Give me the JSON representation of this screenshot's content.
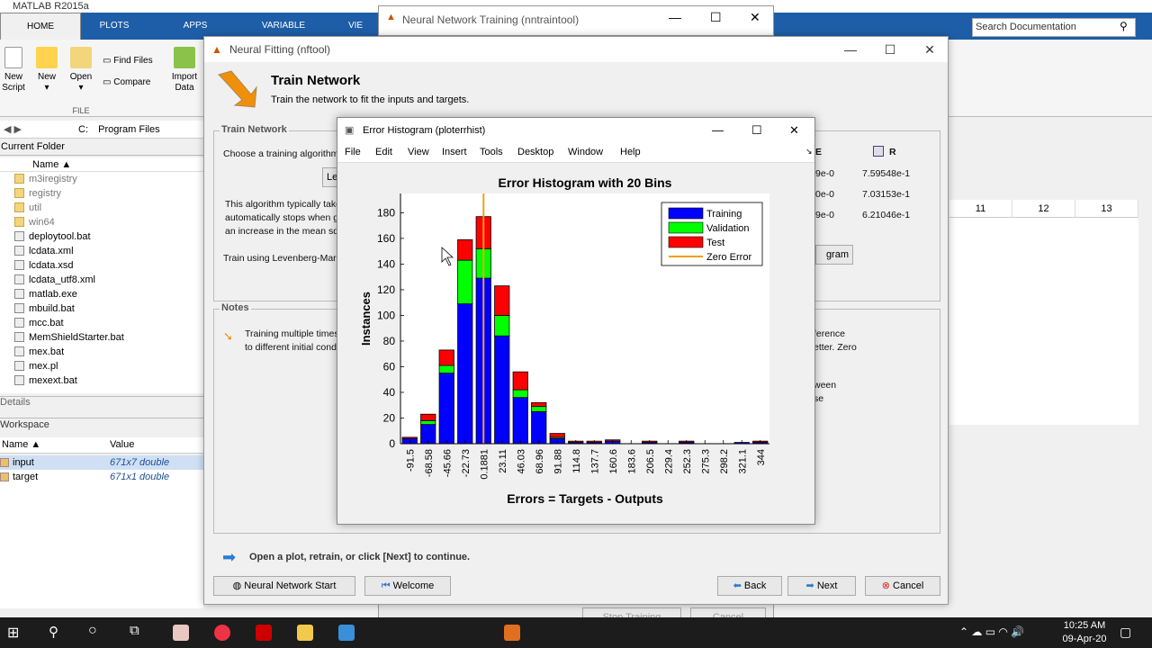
{
  "matlab": {
    "title": "MATLAB R2015a",
    "tabs": [
      "HOME",
      "PLOTS",
      "APPS",
      "VARIABLE",
      "VIE"
    ],
    "ribbon": {
      "new_script": "New\nScript",
      "new": "New",
      "open": "Open",
      "find_files": "Find Files",
      "compare": "Compare",
      "import_data": "Import\nData",
      "file_group": "FILE"
    },
    "search_placeholder": "Search Documentation",
    "path": [
      "C:",
      "Program Files"
    ],
    "current_folder_label": "Current Folder",
    "name_header": "Name",
    "files": [
      {
        "name": "m3iregistry",
        "folder": true
      },
      {
        "name": "registry",
        "folder": true
      },
      {
        "name": "util",
        "folder": true
      },
      {
        "name": "win64",
        "folder": true
      },
      {
        "name": "deploytool.bat",
        "folder": false
      },
      {
        "name": "lcdata.xml",
        "folder": false
      },
      {
        "name": "lcdata.xsd",
        "folder": false
      },
      {
        "name": "lcdata_utf8.xml",
        "folder": false
      },
      {
        "name": "matlab.exe",
        "folder": false
      },
      {
        "name": "mbuild.bat",
        "folder": false
      },
      {
        "name": "mcc.bat",
        "folder": false
      },
      {
        "name": "MemShieldStarter.bat",
        "folder": false
      },
      {
        "name": "mex.bat",
        "folder": false
      },
      {
        "name": "mex.pl",
        "folder": false
      },
      {
        "name": "mexext.bat",
        "folder": false
      }
    ],
    "details_label": "Details",
    "workspace_label": "Workspace",
    "ws_name_header": "Name",
    "ws_value_header": "Value",
    "workspace": [
      {
        "name": "input",
        "value": "671x7 double"
      },
      {
        "name": "target",
        "value": "671x1 double"
      }
    ],
    "grid_columns": [
      "11",
      "12",
      "13"
    ]
  },
  "nntraintool": {
    "title": "Neural Network Training (nntraintool)",
    "stop_training": "Stop Training",
    "cancel": "Cancel"
  },
  "nftool": {
    "title": "Neural Fitting (nftool)",
    "heading": "Train Network",
    "subheading": "Train the network to fit the inputs and targets.",
    "train_panel_title": "Train Network",
    "choose_text": "Choose a training algorithm:",
    "algo_button": "Lev",
    "algo_desc_1": "This algorithm typically takes more memory but less time. Training",
    "algo_desc_2": "automatically stops when generalization stops improving, as indicated by",
    "algo_desc_3": "an increase in the mean square error of the validation samples.",
    "train_using": "Train using Levenberg-Marquardt.",
    "results_headers": [
      "E",
      "R"
    ],
    "r_values": [
      "7.59548e-1",
      "7.03153e-1",
      "6.21046e-1"
    ],
    "mse_partial": [
      "9e-0",
      "0e-0",
      "9e-0"
    ],
    "plot_button": "gram",
    "notes_title": "Notes",
    "note_1a": "Training multiple times will generate different results due",
    "note_1b": "to different initial conditions and sampling.",
    "note_r1": "ference",
    "note_r2": "etter. Zero",
    "note_r3": "ween",
    "note_r4": "se",
    "footer_hint": "Open a plot, retrain, or click [Next] to continue.",
    "btn_nn_start": "Neural Network Start",
    "btn_welcome": "Welcome",
    "btn_back": "Back",
    "btn_next": "Next",
    "btn_cancel": "Cancel"
  },
  "histogram_window": {
    "title": "Error Histogram (ploterrhist)",
    "menu": [
      "File",
      "Edit",
      "View",
      "Insert",
      "Tools",
      "Desktop",
      "Window",
      "Help"
    ]
  },
  "chart_data": {
    "type": "bar",
    "title": "Error Histogram with 20 Bins",
    "xlabel": "Errors = Targets - Outputs",
    "ylabel": "Instances",
    "ylim": [
      0,
      195
    ],
    "yticks": [
      0,
      20,
      40,
      60,
      80,
      100,
      120,
      140,
      160,
      180
    ],
    "categories": [
      "-91.5",
      "-68.58",
      "-45.66",
      "-22.73",
      "0.1881",
      "23.11",
      "46.03",
      "68.96",
      "91.88",
      "114.8",
      "137.7",
      "160.6",
      "183.6",
      "206.5",
      "229.4",
      "252.3",
      "275.3",
      "298.2",
      "321.1",
      "344"
    ],
    "series": [
      {
        "name": "Training",
        "color": "#0000ff",
        "values": [
          4,
          15,
          55,
          109,
          129,
          84,
          36,
          25,
          4,
          1,
          1,
          2,
          0,
          1,
          0,
          1,
          0,
          0,
          1,
          1
        ]
      },
      {
        "name": "Validation",
        "color": "#00ff00",
        "values": [
          0,
          3,
          6,
          34,
          23,
          16,
          6,
          4,
          1,
          0,
          0,
          0,
          0,
          0,
          0,
          0,
          0,
          0,
          0,
          0
        ]
      },
      {
        "name": "Test",
        "color": "#ff0000",
        "values": [
          1,
          5,
          12,
          16,
          25,
          23,
          14,
          3,
          3,
          1,
          1,
          1,
          0,
          1,
          0,
          1,
          0,
          0,
          0,
          1
        ]
      }
    ],
    "zero_error": {
      "name": "Zero Error",
      "color": "#f0a020",
      "x": 0
    },
    "legend_position": "top-right",
    "grid": false
  },
  "taskbar": {
    "time": "10:25 AM",
    "date": "09-Apr-20"
  }
}
